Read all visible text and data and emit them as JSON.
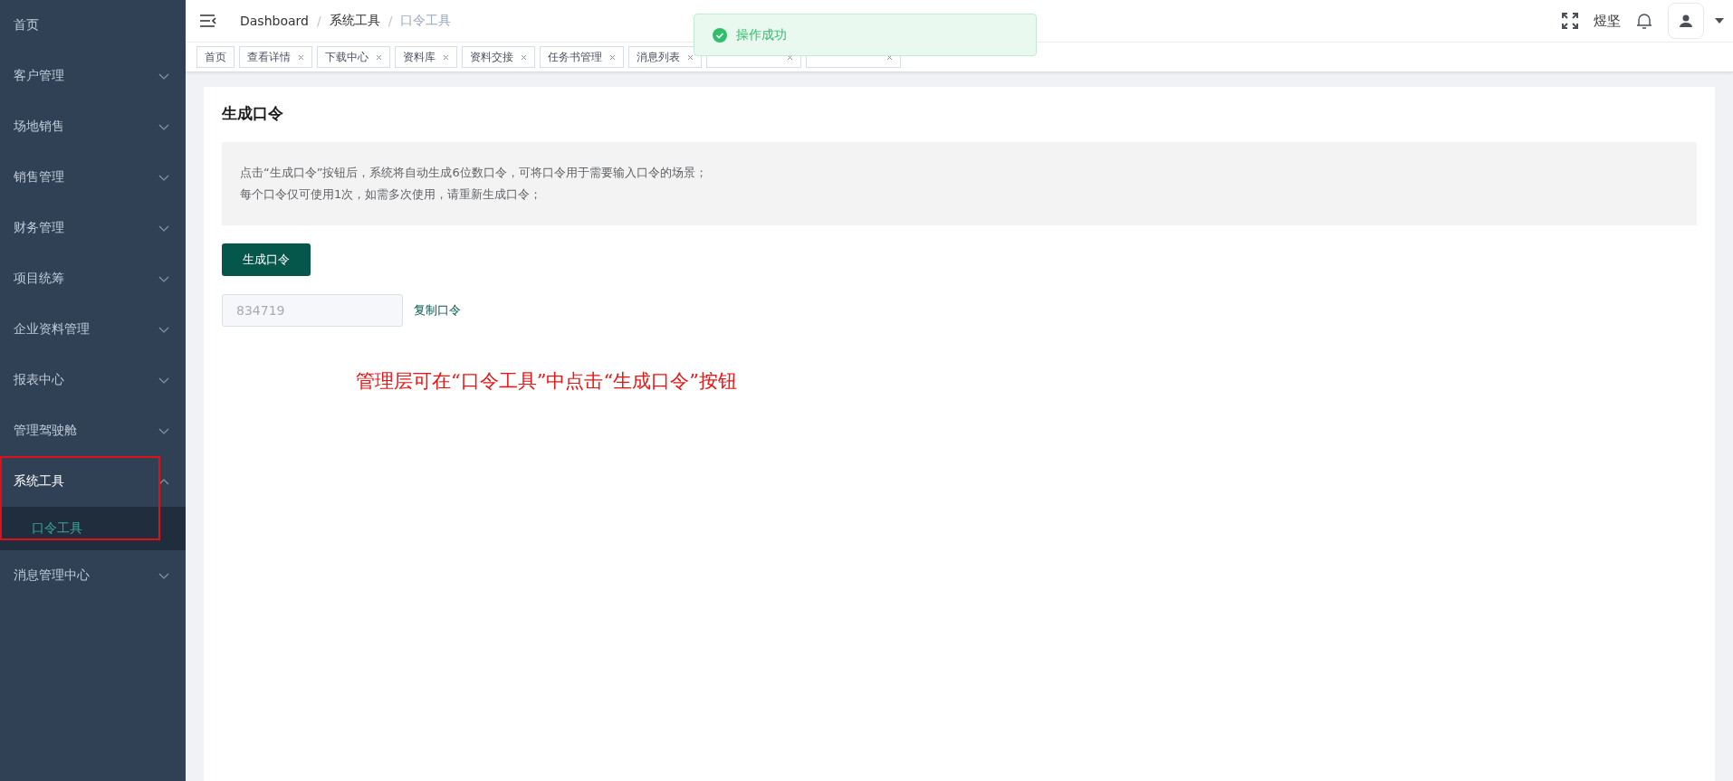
{
  "sidebar": {
    "items": [
      {
        "label": "首页",
        "kind": "link"
      },
      {
        "label": "客户管理",
        "kind": "submenu",
        "expanded": false
      },
      {
        "label": "场地销售",
        "kind": "submenu",
        "expanded": false
      },
      {
        "label": "销售管理",
        "kind": "submenu",
        "expanded": false
      },
      {
        "label": "财务管理",
        "kind": "submenu",
        "expanded": false
      },
      {
        "label": "项目统筹",
        "kind": "submenu",
        "expanded": false
      },
      {
        "label": "企业资料管理",
        "kind": "submenu",
        "expanded": false
      },
      {
        "label": "报表中心",
        "kind": "submenu",
        "expanded": false
      },
      {
        "label": "管理驾驶舱",
        "kind": "submenu",
        "expanded": false
      },
      {
        "label": "系统工具",
        "kind": "submenu",
        "expanded": true,
        "highlighted": true,
        "children": [
          {
            "label": "口令工具",
            "selected": true
          }
        ]
      },
      {
        "label": "消息管理中心",
        "kind": "submenu",
        "expanded": false
      }
    ]
  },
  "breadcrumb": [
    "Dashboard",
    "系统工具",
    "口令工具"
  ],
  "breadcrumb_separator": "/",
  "header": {
    "user_name": "煜坚"
  },
  "tags": [
    {
      "label": "首页",
      "closable": false
    },
    {
      "label": "查看详情",
      "closable": true
    },
    {
      "label": "下载中心",
      "closable": true
    },
    {
      "label": "资料库",
      "closable": true
    },
    {
      "label": "资料交接",
      "closable": true
    },
    {
      "label": "任务书管理",
      "closable": true
    },
    {
      "label": "消息列表",
      "closable": true
    },
    {
      "closable": true
    },
    {
      "closable": true
    }
  ],
  "toast": {
    "message": "操作成功"
  },
  "card": {
    "title": "生成口令",
    "notes": [
      "点击“生成口令”按钮后，系统将自动生成6位数口令，可将口令用于需要输入口令的场景；",
      "每个口令仅可使用1次，如需多次使用，请重新生成口令；"
    ],
    "generate_button": "生成口令",
    "code_value": "834719",
    "copy_link": "复制口令"
  },
  "annotation": "管理层可在“口令工具”中点击“生成口令”按钮"
}
